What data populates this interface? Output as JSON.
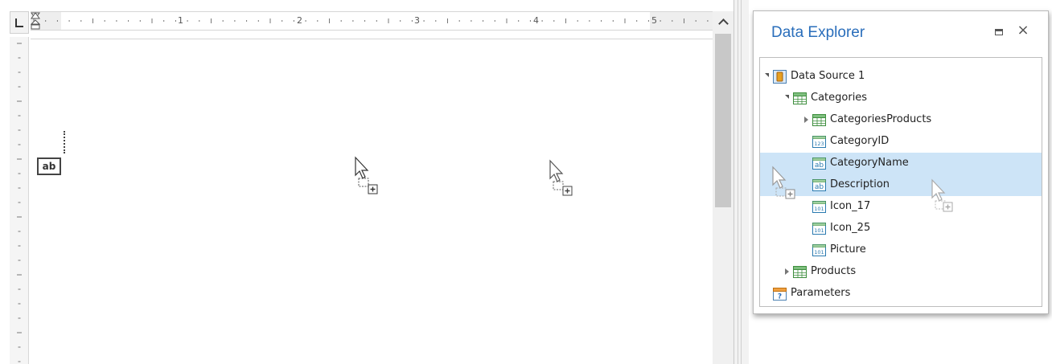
{
  "ruler": {
    "numbers": [
      "1",
      "2",
      "3",
      "4",
      "5"
    ]
  },
  "designer": {
    "label_control": "ab"
  },
  "panel": {
    "title": "Data Explorer",
    "close_glyph": "×",
    "tree": [
      {
        "label": "Data Source 1",
        "icon": "datasource-icon",
        "level": 0,
        "expander": "open",
        "selected": false
      },
      {
        "label": "Categories",
        "icon": "table-icon",
        "level": 1,
        "expander": "open",
        "selected": false
      },
      {
        "label": "CategoriesProducts",
        "icon": "table-icon",
        "level": 2,
        "expander": "closed",
        "selected": false
      },
      {
        "label": "CategoryID",
        "icon": "numeric-field-icon",
        "level": 2,
        "expander": "none",
        "selected": false
      },
      {
        "label": "CategoryName",
        "icon": "string-field-icon",
        "level": 2,
        "expander": "none",
        "selected": true
      },
      {
        "label": "Description",
        "icon": "string-field-icon",
        "level": 2,
        "expander": "none",
        "selected": true
      },
      {
        "label": "Icon_17",
        "icon": "binary-field-icon",
        "level": 2,
        "expander": "none",
        "selected": false
      },
      {
        "label": "Icon_25",
        "icon": "binary-field-icon",
        "level": 2,
        "expander": "none",
        "selected": false
      },
      {
        "label": "Picture",
        "icon": "binary-field-icon",
        "level": 2,
        "expander": "none",
        "selected": false
      },
      {
        "label": "Products",
        "icon": "table-icon",
        "level": 1,
        "expander": "closed",
        "selected": false
      },
      {
        "label": "Parameters",
        "icon": "parameters-icon",
        "level": 0,
        "expander": "none",
        "selected": false
      }
    ]
  },
  "icon_text": {
    "numeric": "123",
    "string": "ab",
    "binary": "101",
    "parameters": "?"
  },
  "colors": {
    "accent": "#2a6ebb",
    "selection": "#cde4f7",
    "table_icon": "#3e8e3e",
    "datasource_icon": "#e8a020",
    "field_icon": "#2a7ab0"
  }
}
